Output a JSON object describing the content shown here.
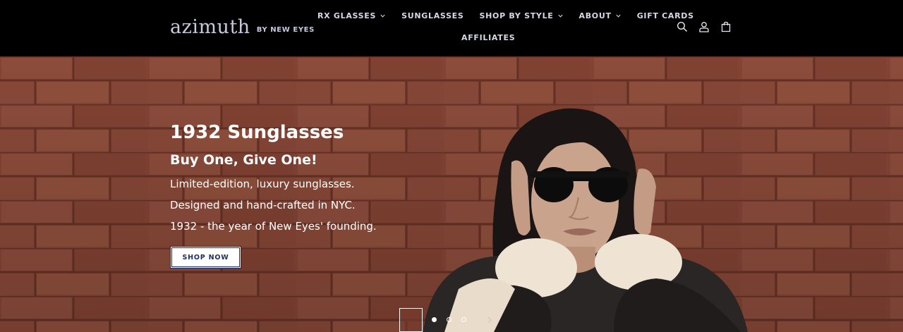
{
  "brand": {
    "logo_main": "azimuth",
    "logo_sub": "BY NEW EYES",
    "logo_color": "#c7c9df"
  },
  "nav": {
    "row1": [
      {
        "label": "RX GLASSES",
        "has_dropdown": true
      },
      {
        "label": "SUNGLASSES",
        "has_dropdown": false
      },
      {
        "label": "SHOP BY STYLE",
        "has_dropdown": true
      },
      {
        "label": "ABOUT",
        "has_dropdown": true
      },
      {
        "label": "GIFT CARDS",
        "has_dropdown": false
      }
    ],
    "row2": [
      {
        "label": "AFFILIATES",
        "has_dropdown": false
      }
    ]
  },
  "header_icons": [
    "search-icon",
    "account-icon",
    "cart-icon"
  ],
  "hero": {
    "title": "1932 Sunglasses",
    "subtitle": "Buy One, Give One!",
    "lines": [
      "Limited-edition, luxury sunglasses.",
      "Designed and hand-crafted in NYC.",
      "1932 - the year of New Eyes' founding."
    ],
    "cta_label": "SHOP NOW",
    "cta_color": "#1f2f63",
    "brick_color": "#8d4a3a"
  },
  "slider": {
    "slide_count": 3,
    "active_index": 0
  }
}
